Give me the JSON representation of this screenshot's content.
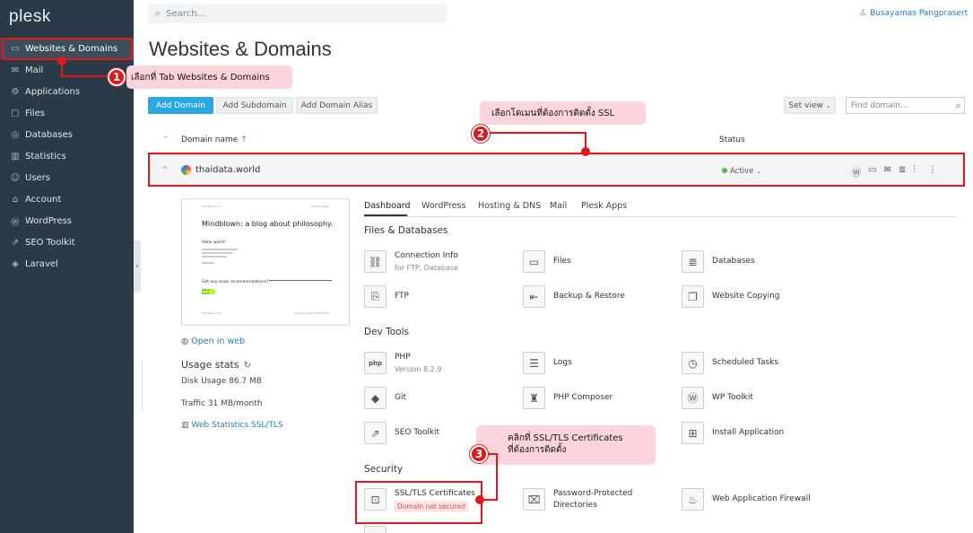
{
  "sidebar": {
    "logo": "plesk",
    "items": [
      {
        "label": "Websites & Domains",
        "icon": "monitor-icon"
      },
      {
        "label": "Mail",
        "icon": "mail-icon"
      },
      {
        "label": "Applications",
        "icon": "gear-icon"
      },
      {
        "label": "Files",
        "icon": "folder-icon"
      },
      {
        "label": "Databases",
        "icon": "database-icon"
      },
      {
        "label": "Statistics",
        "icon": "chart-icon"
      },
      {
        "label": "Users",
        "icon": "user-icon"
      },
      {
        "label": "Account",
        "icon": "account-icon"
      },
      {
        "label": "WordPress",
        "icon": "wordpress-icon"
      },
      {
        "label": "SEO Toolkit",
        "icon": "seo-icon"
      },
      {
        "label": "Laravel",
        "icon": "laravel-icon"
      }
    ]
  },
  "header": {
    "search_placeholder": "Search...",
    "user": "Busayamas Pangprasert"
  },
  "page": {
    "title": "Websites & Domains"
  },
  "toolbar": {
    "add_domain": "Add Domain",
    "add_subdomain": "Add Subdomain",
    "add_alias": "Add Domain Alias",
    "set_view": "Set view",
    "find_placeholder": "Find domain..."
  },
  "list": {
    "col_name": "Domain name",
    "col_status": "Status",
    "domain": "thaidata.world",
    "status": "Active"
  },
  "preview": {
    "top_left": "thaidata.world",
    "top_right": "Sample Page",
    "headline": "Mindblown: a blog about philosophy.",
    "hello": "Hello world!",
    "question": "Got any book recommendations?",
    "button": "Get in touch",
    "foot_left": "thaidata.world",
    "foot_right": "Designed with WordPress"
  },
  "side_info": {
    "open_in_web": "Open in web",
    "usage_title": "Usage stats",
    "disk": "Disk Usage 86.7 MB",
    "traffic": "Traffic 31 MB/month",
    "web_stats": "Web Statistics SSL/TLS"
  },
  "tabs": [
    "Dashboard",
    "WordPress",
    "Hosting & DNS",
    "Mail",
    "Plesk Apps"
  ],
  "sections": {
    "files_db": {
      "title": "Files & Databases",
      "tools": [
        {
          "label": "Connection Info",
          "sub": "for FTP, Database"
        },
        {
          "label": "Files"
        },
        {
          "label": "Databases"
        },
        {
          "label": "FTP"
        },
        {
          "label": "Backup & Restore"
        },
        {
          "label": "Website Copying"
        }
      ]
    },
    "dev": {
      "title": "Dev Tools",
      "tools": [
        {
          "label": "PHP",
          "sub": "Version 8.2.9"
        },
        {
          "label": "Logs"
        },
        {
          "label": "Scheduled Tasks"
        },
        {
          "label": "Git"
        },
        {
          "label": "PHP Composer"
        },
        {
          "label": "WP Toolkit"
        },
        {
          "label": "SEO Toolkit"
        },
        {
          "label": "Install Application"
        }
      ]
    },
    "security": {
      "title": "Security",
      "tools": [
        {
          "label": "SSL/TLS Certificates",
          "badge": "Domain not secured"
        },
        {
          "label": "Password-Protected",
          "sub2": "Directories"
        },
        {
          "label": "Web Application Firewall"
        }
      ]
    }
  },
  "annotations": {
    "step1": {
      "num": "1",
      "text": "เลือกที่ Tab Websites & Domains"
    },
    "step2": {
      "num": "2",
      "text": "เลือกโดเมนที่ต้องการติดตั้ง SSL"
    },
    "step3": {
      "num": "3",
      "line1": "คลิกที่ SSL/TLS Certificates",
      "line2": "ที่ต้องการติดตั้ง"
    },
    "color": "#e3161b",
    "callout_bg": "#fcd5dc"
  }
}
